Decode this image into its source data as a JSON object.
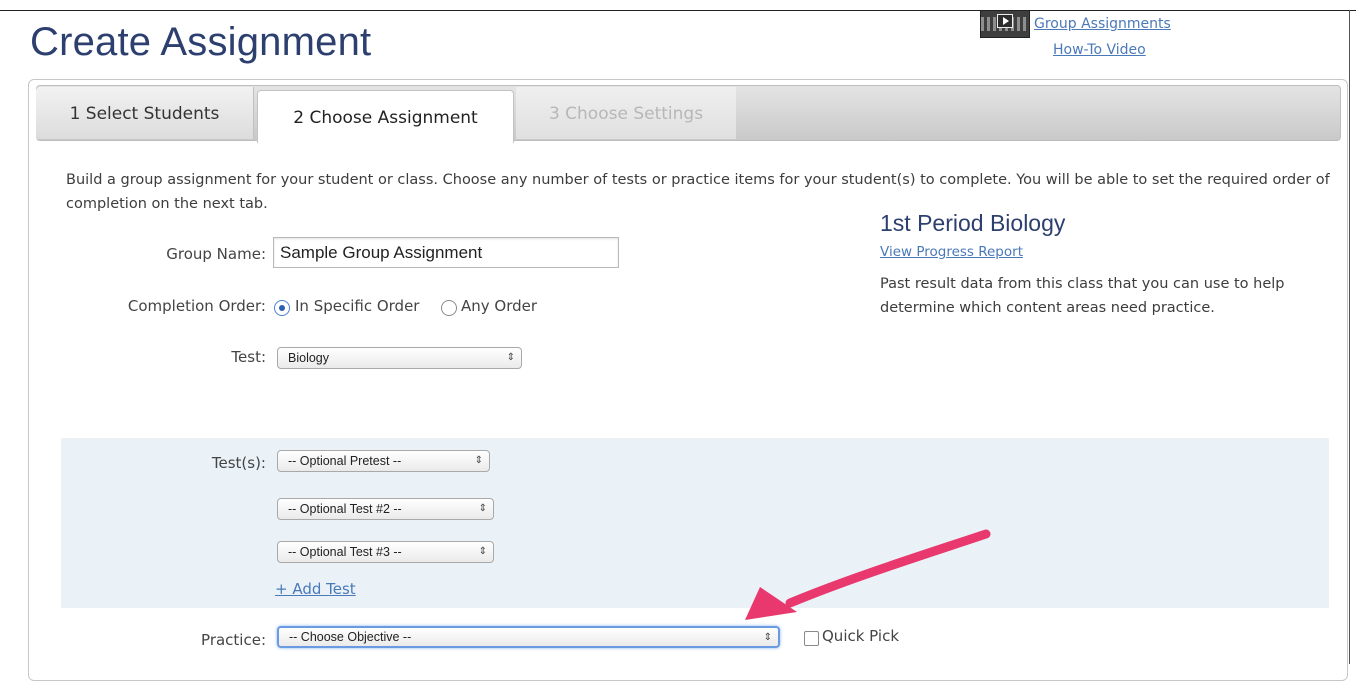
{
  "header": {
    "title": "Create Assignment",
    "video_link_line1": "Group Assignments",
    "video_link_line2": "How-To Video"
  },
  "tabs": [
    {
      "label": "1 Select Students",
      "state": "inactive"
    },
    {
      "label": "2 Choose Assignment",
      "state": "active"
    },
    {
      "label": "3 Choose Settings",
      "state": "disabled"
    }
  ],
  "description": "Build a group assignment for your student or class. Choose any number of tests or practice items for your student(s) to complete. You will be able to set the required order of completion on the next tab.",
  "form": {
    "group_name_label": "Group Name:",
    "group_name_value": "Sample Group Assignment",
    "completion_order_label": "Completion Order:",
    "completion_options": [
      {
        "label": "In Specific Order",
        "checked": true
      },
      {
        "label": "Any Order",
        "checked": false
      }
    ],
    "test_label": "Test:",
    "test_value": "Biology",
    "tests_label": "Test(s):",
    "tests_selects": [
      "-- Optional Pretest --",
      "-- Optional Test #2 --",
      "-- Optional Test #3 --"
    ],
    "add_test_label": "+ Add Test",
    "practice_label": "Practice:",
    "practice_value": "-- Choose Objective --",
    "quick_pick_label": "Quick Pick",
    "select_arrows": "⇕"
  },
  "sidebar": {
    "title": "1st Period Biology",
    "link": "View Progress Report",
    "text": "Past result data from this class that you can use to help determine which content areas need practice."
  },
  "colors": {
    "title_blue": "#2c3f6e",
    "link_blue": "#4a79b8",
    "band_blue": "#eaf2f8",
    "annotation_arrow": "#e8386d"
  },
  "icons": {
    "video": "video-thumbnail-icon",
    "play": "play-icon",
    "select_arrows": "updown-arrows-icon",
    "annotation": "pink-arrow-annotation"
  }
}
